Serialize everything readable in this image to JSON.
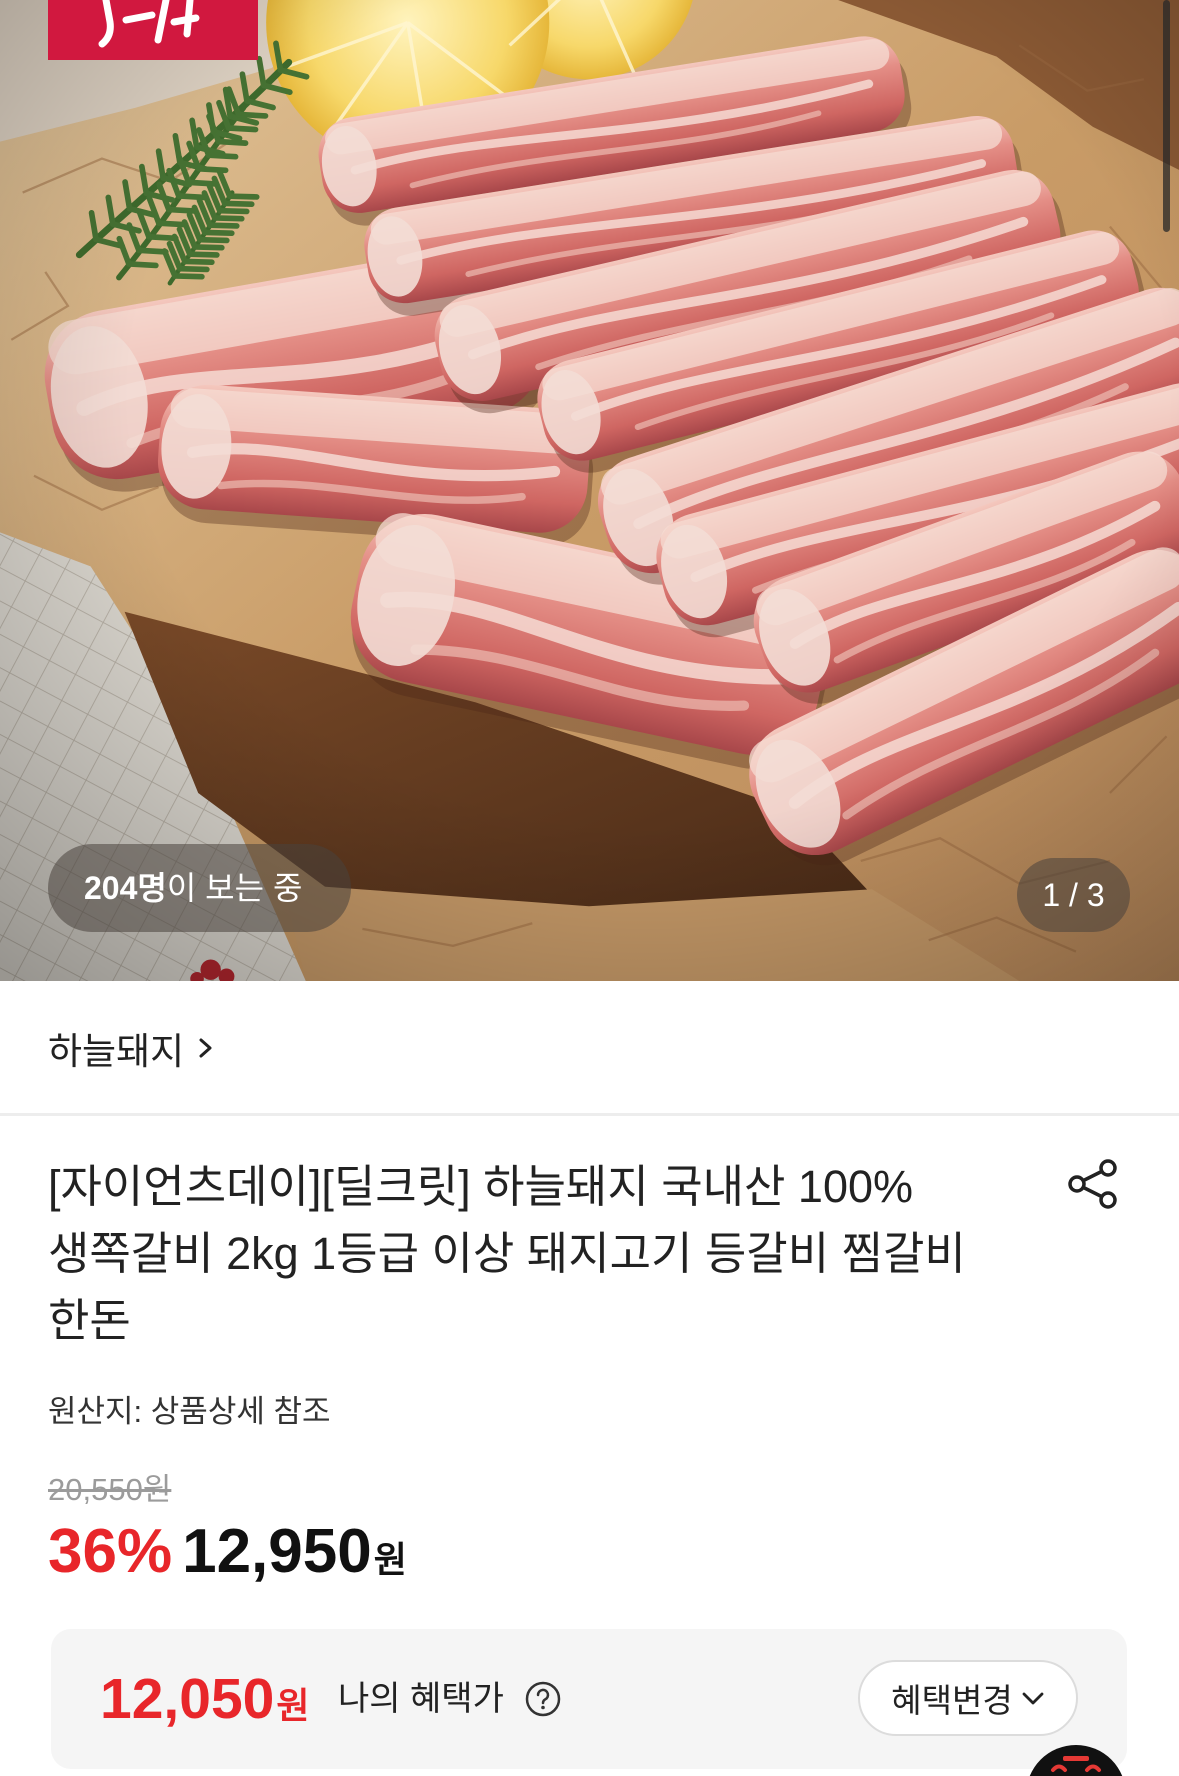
{
  "hero": {
    "viewer_count": "204명",
    "viewer_suffix": "이 보는 중",
    "page_indicator": "1 / 3"
  },
  "store": {
    "name": "하늘돼지",
    "link_icon": "chevron-right-icon"
  },
  "product": {
    "title_lines": [
      "[자이언츠데이][딜크릿] 하늘돼지 국내산 100%",
      "생쪽갈비 2kg 1등급 이상 돼지고기 등갈비 찜갈비",
      "한돈"
    ],
    "share_icon": "share-icon",
    "origin": "원산지: 상품상세 참조",
    "original_price": "20,550원",
    "discount_rate": "36%",
    "sale_price": "12,950",
    "sale_price_unit": "원"
  },
  "benefit": {
    "price": "12,050",
    "price_unit": "원",
    "label": "나의 혜택가",
    "help_icon": "question-circle-icon",
    "change_button_label": "혜택변경",
    "change_button_icon": "chevron-down-icon"
  },
  "colors": {
    "accent_red": "#e8262a",
    "brand_badge": "#d1183f",
    "text_primary": "#222222",
    "text_muted": "#9b9b9b",
    "benefit_bg": "#f5f5f5"
  }
}
